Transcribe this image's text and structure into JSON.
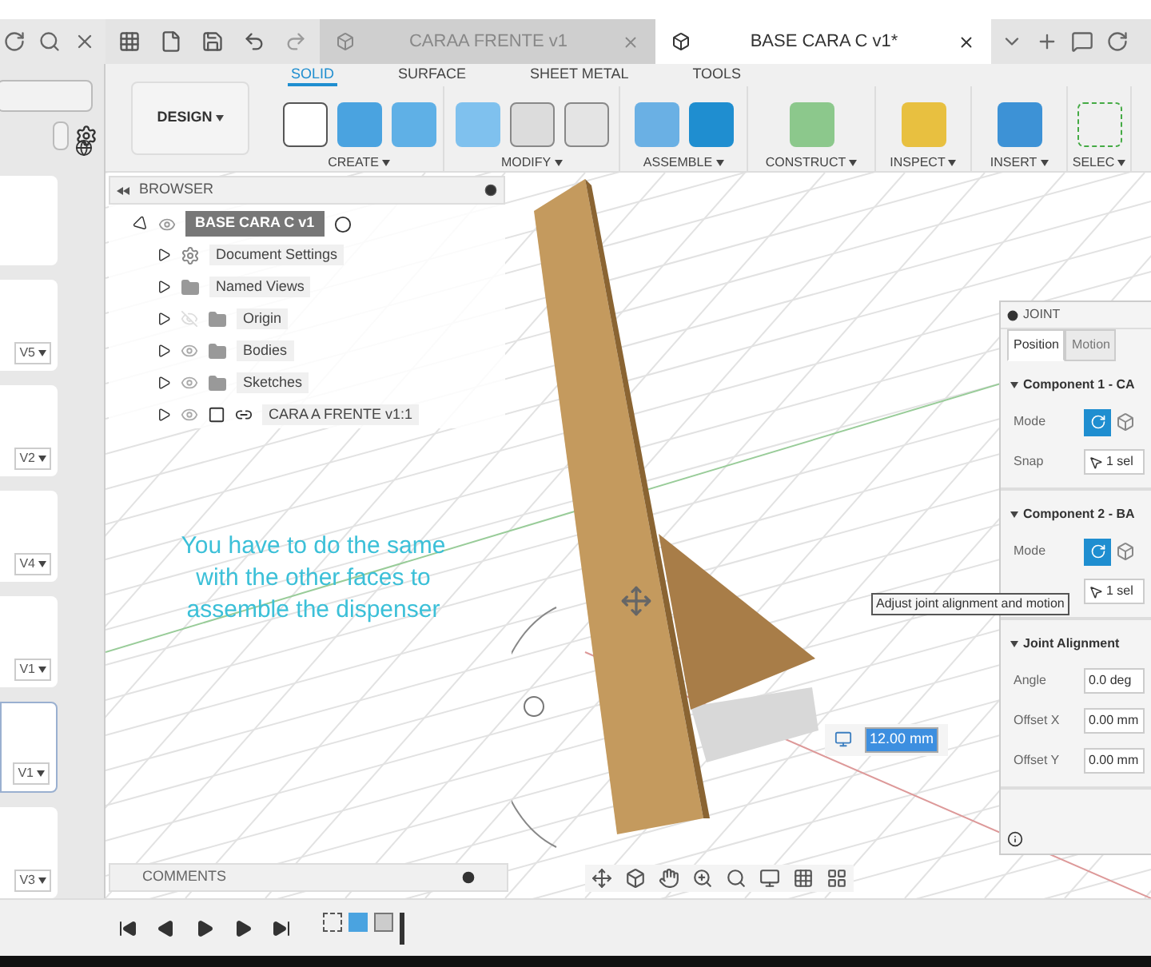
{
  "file_versions": [
    {
      "label": "V5",
      "selected": false
    },
    {
      "label": "V2",
      "selected": false
    },
    {
      "label": "V4",
      "selected": false
    },
    {
      "label": "V1",
      "selected": false
    },
    {
      "label": "V1",
      "selected": true
    },
    {
      "label": "V3",
      "selected": false
    }
  ],
  "document_tabs": [
    {
      "label": "CARAA FRENTE v1",
      "selected": false
    },
    {
      "label": "BASE CARA C v1*",
      "selected": true
    }
  ],
  "toolbar": {
    "workspace": "DESIGN",
    "tabs": [
      {
        "label": "SOLID",
        "selected": true
      },
      {
        "label": "SURFACE",
        "selected": false
      },
      {
        "label": "SHEET METAL",
        "selected": false
      },
      {
        "label": "TOOLS",
        "selected": false
      }
    ],
    "groups": [
      "CREATE",
      "MODIFY",
      "ASSEMBLE",
      "CONSTRUCT",
      "INSPECT",
      "INSERT",
      "SELEC"
    ]
  },
  "browser": {
    "title": "BROWSER",
    "root": {
      "label": "BASE CARA C v1",
      "expanded": true,
      "children": [
        {
          "label": "Document Settings",
          "kind": "settings"
        },
        {
          "label": "Named Views",
          "kind": "folder"
        },
        {
          "label": "Origin",
          "kind": "folder",
          "visible": false
        },
        {
          "label": "Bodies",
          "kind": "folder",
          "visible": true
        },
        {
          "label": "Sketches",
          "kind": "folder",
          "visible": true
        },
        {
          "label": "CARA A FRENTE v1:1",
          "kind": "component",
          "visible": true
        }
      ]
    }
  },
  "annotation": "You have to do the same\nwith the other faces to\nassemble the dispenser",
  "tooltip": "Adjust joint alignment and motion",
  "distance_field": "12.00 mm",
  "joint": {
    "title": "JOINT",
    "tabs": [
      {
        "label": "Position",
        "selected": true
      },
      {
        "label": "Motion",
        "selected": false
      }
    ],
    "sections": [
      {
        "title": "Component 1 - CA",
        "rows": [
          {
            "kind": "mode",
            "label": "Mode"
          },
          {
            "kind": "select",
            "label": "Snap",
            "value": "1 sel"
          }
        ]
      },
      {
        "title": "Component 2 - BA",
        "rows": [
          {
            "kind": "mode",
            "label": "Mode"
          },
          {
            "kind": "select",
            "value": "1 sel"
          }
        ]
      },
      {
        "title": "Joint Alignment",
        "rows": [
          {
            "kind": "input",
            "label": "Angle",
            "value": "0.0 deg"
          },
          {
            "kind": "input",
            "label": "Offset X",
            "value": "0.00 mm"
          },
          {
            "kind": "input",
            "label": "Offset Y",
            "value": "0.00 mm"
          }
        ]
      }
    ]
  },
  "comments": "COMMENTS"
}
